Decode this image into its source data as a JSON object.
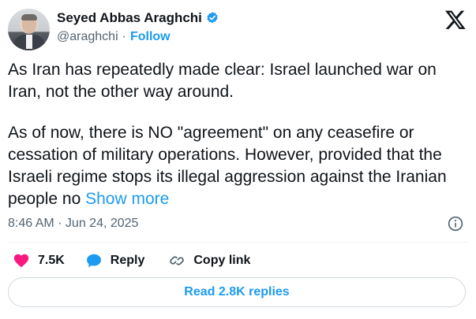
{
  "author": {
    "name": "Seyed Abbas Araghchi",
    "handle": "@araghchi",
    "separator": "·",
    "follow_label": "Follow",
    "verified_icon": "verified-badge-icon",
    "verified_color": "#1d9bf0"
  },
  "brand": {
    "logo_icon": "x-logo-icon"
  },
  "tweet": {
    "paragraph_1": "As Iran has repeatedly made clear: Israel launched war on Iran, not the other way around.",
    "paragraph_2": "As of now, there is NO \"agreement\" on any ceasefire or cessation of military operations. However, provided that the Israeli regime stops its illegal aggression against the Iranian people no",
    "show_more_label": "Show more",
    "timestamp": "8:46 AM · Jun 24, 2025"
  },
  "actions": {
    "like_count": "7.5K",
    "like_color": "#f91880",
    "reply_label": "Reply",
    "reply_color": "#1d9bf0",
    "copy_link_label": "Copy link"
  },
  "footer": {
    "read_replies_label": "Read 2.8K replies"
  },
  "colors": {
    "accent": "#1d9bf0",
    "text": "#0f1419",
    "secondary": "#536471"
  }
}
